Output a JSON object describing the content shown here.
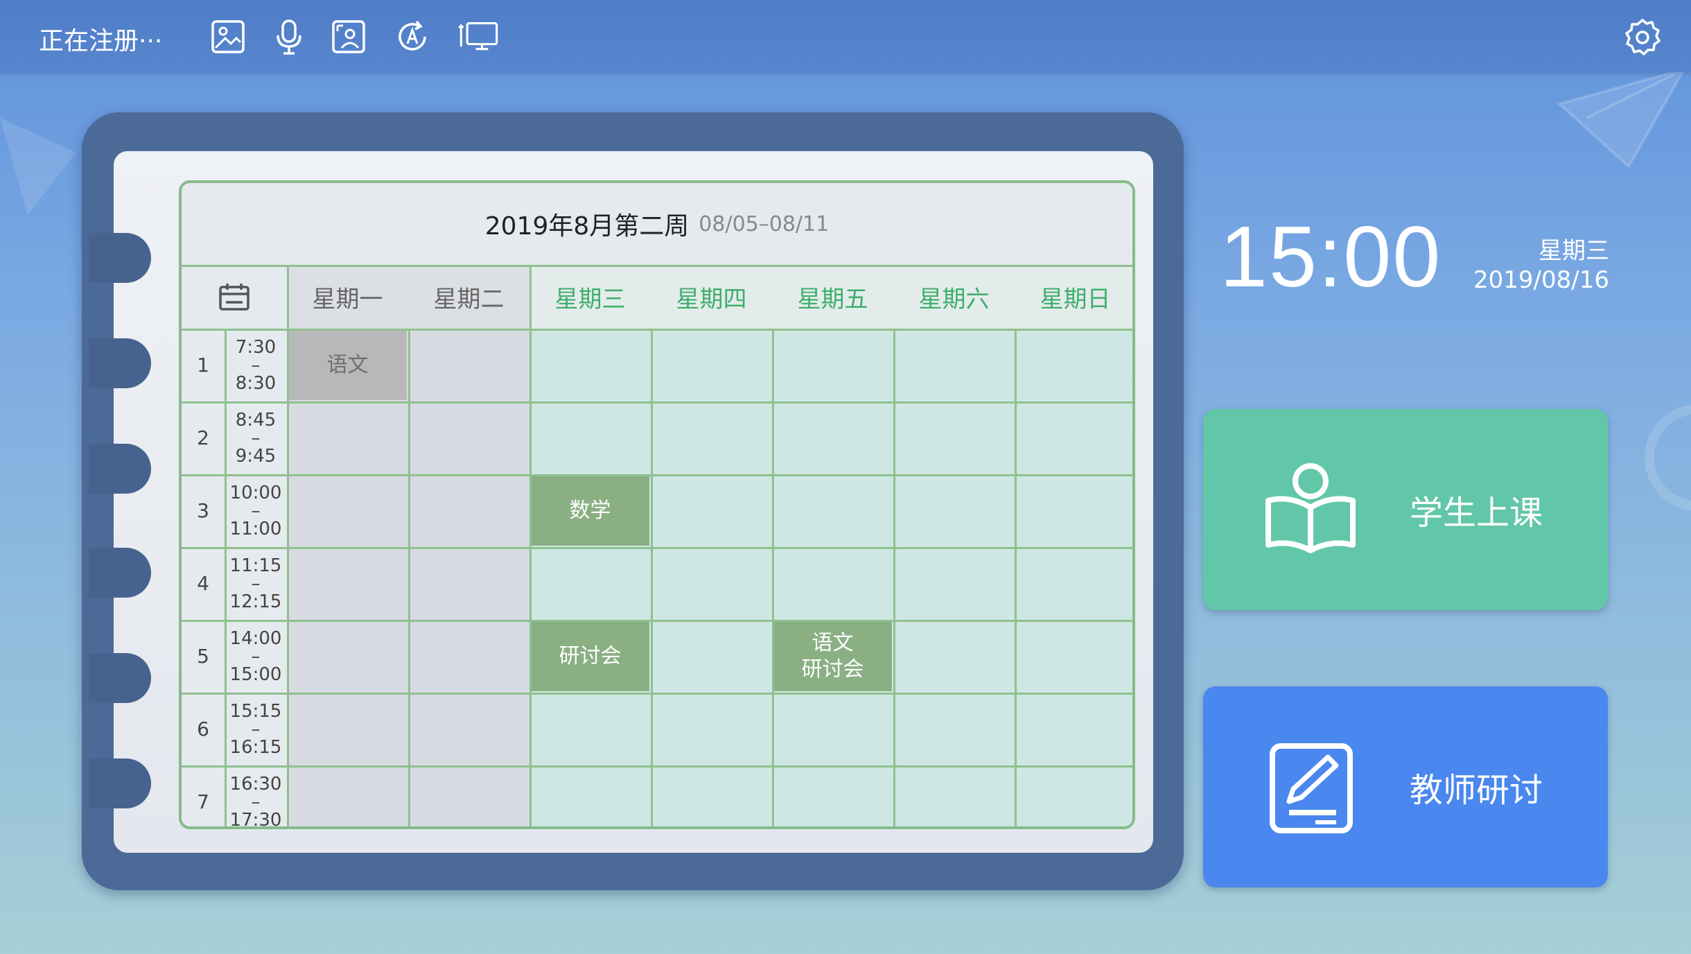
{
  "topbar": {
    "status_text": "正在注册···",
    "tools": [
      {
        "icon": "image-icon"
      },
      {
        "icon": "microphone-icon"
      },
      {
        "icon": "portrait-icon"
      },
      {
        "icon": "auto-a-icon"
      },
      {
        "icon": "screen-cast-icon"
      }
    ],
    "settings_icon": "gear-icon"
  },
  "timetable": {
    "title": "2019年8月第二周",
    "range": "08/05–08/11",
    "calendar_icon": "calendar-icon",
    "days": [
      "星期一",
      "星期二",
      "星期三",
      "星期四",
      "星期五",
      "星期六",
      "星期日"
    ],
    "periods": [
      {
        "no": "1",
        "start": "7:30",
        "sep": "–",
        "end": "8:30"
      },
      {
        "no": "2",
        "start": "8:45",
        "sep": "–",
        "end": "9:45"
      },
      {
        "no": "3",
        "start": "10:00",
        "sep": "–",
        "end": "11:00"
      },
      {
        "no": "4",
        "start": "11:15",
        "sep": "–",
        "end": "12:15"
      },
      {
        "no": "5",
        "start": "14:00",
        "sep": "–",
        "end": "15:00"
      },
      {
        "no": "6",
        "start": "15:15",
        "sep": "–",
        "end": "16:15"
      },
      {
        "no": "7",
        "start": "16:30",
        "sep": "–",
        "end": "17:30"
      }
    ],
    "entries": [
      {
        "period": 0,
        "day": 0,
        "lines": [
          "语文"
        ],
        "state": "past"
      },
      {
        "period": 2,
        "day": 2,
        "lines": [
          "数学"
        ],
        "state": "active"
      },
      {
        "period": 4,
        "day": 2,
        "lines": [
          "研讨会"
        ],
        "state": "active"
      },
      {
        "period": 4,
        "day": 4,
        "lines": [
          "语文",
          "研讨会"
        ],
        "state": "active"
      }
    ],
    "colors": {
      "past_header": "#666666",
      "future_header": "#3fae6c",
      "past_cell": "#d7dbe1",
      "future_cell": "#cfe7e4",
      "line": "#8fc08f",
      "active_course": "#8aaf83",
      "past_course": "#b8b8ba"
    }
  },
  "clock": {
    "time": "15:00",
    "weekday": "星期三",
    "date": "2019/08/16"
  },
  "buttons": {
    "student": {
      "label": "学生上课",
      "icon": "reading-student-icon",
      "color": "#62c7a8"
    },
    "teacher": {
      "label": "教师研讨",
      "icon": "edit-document-icon",
      "color": "#4a87ee"
    }
  }
}
